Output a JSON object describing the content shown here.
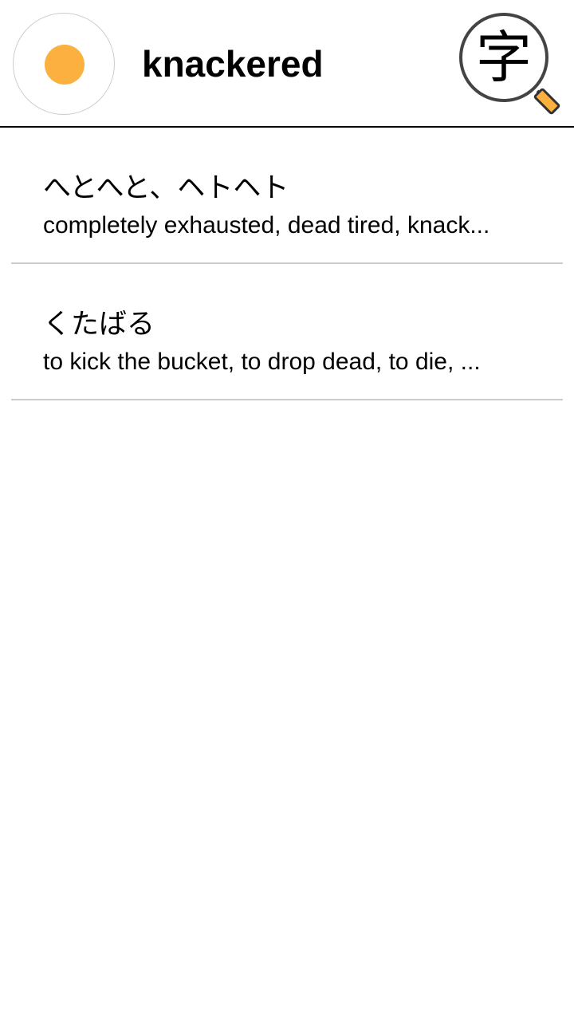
{
  "header": {
    "status_color": "#fbb040",
    "search_term": "knackered",
    "kanji_lookup_icon": {
      "name": "kanji-search-icon",
      "glyph": "字",
      "handle_color": "#fbb040"
    }
  },
  "results": [
    {
      "reading": "へとへと、ヘトヘト",
      "gloss": "completely exhausted, dead tired, knack..."
    },
    {
      "reading": "くたばる",
      "gloss": "to kick the bucket, to drop dead, to die, ..."
    }
  ]
}
